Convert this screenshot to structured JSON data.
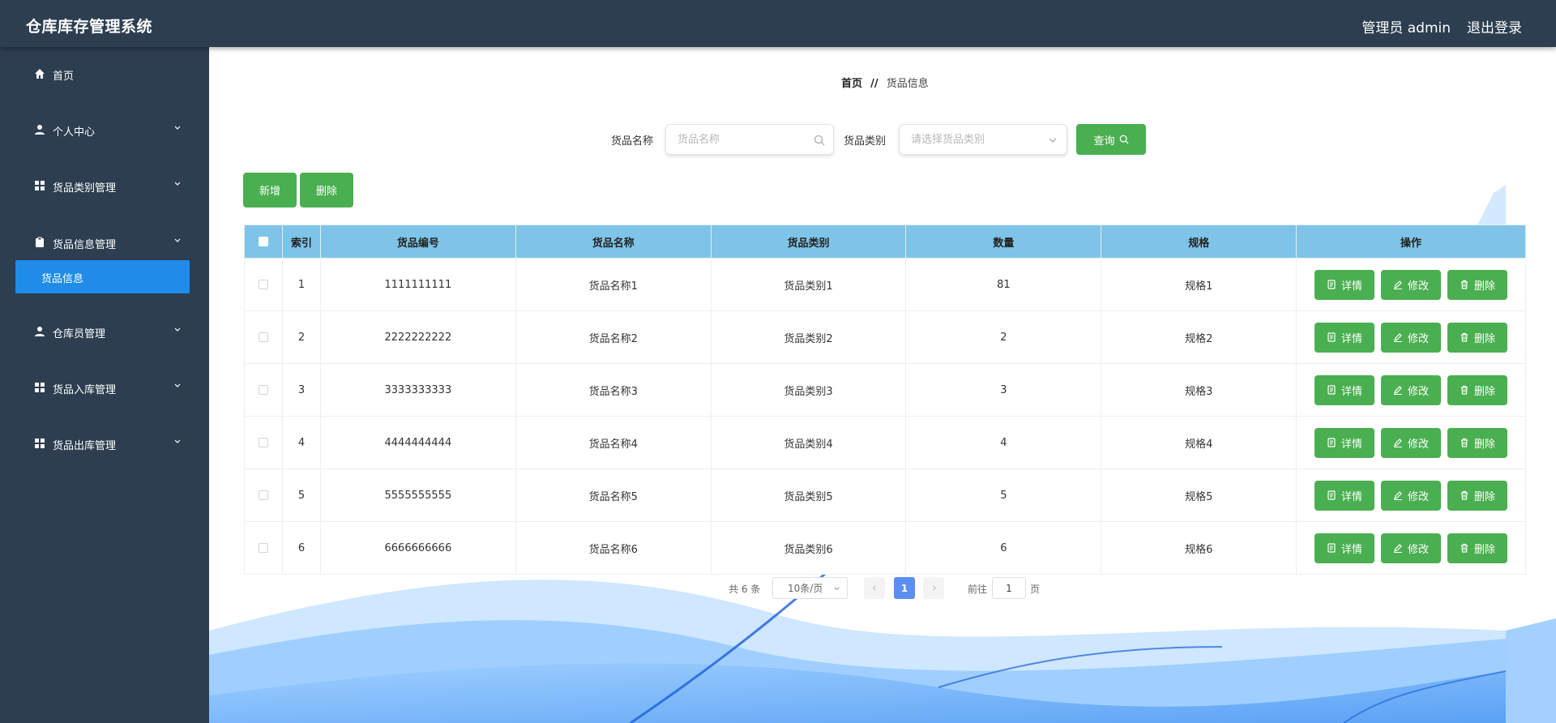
{
  "header": {
    "title": "仓库库存管理系统",
    "admin_label": "管理员 admin",
    "logout_label": "退出登录"
  },
  "sidebar": {
    "items": [
      {
        "label": "首页",
        "icon": "home-icon"
      },
      {
        "label": "个人中心",
        "icon": "user-icon"
      },
      {
        "label": "货品类别管理",
        "icon": "grid-icon"
      },
      {
        "label": "货品信息管理",
        "icon": "clipboard-icon"
      },
      {
        "label": "仓库员管理",
        "icon": "user-icon"
      },
      {
        "label": "货品入库管理",
        "icon": "grid-icon"
      },
      {
        "label": "货品出库管理",
        "icon": "grid-icon"
      }
    ],
    "active_sub": "货品信息"
  },
  "breadcrumb": {
    "home": "首页",
    "sep": "//",
    "current": "货品信息"
  },
  "search": {
    "name_label": "货品名称",
    "name_placeholder": "货品名称",
    "category_label": "货品类别",
    "category_placeholder": "请选择货品类别",
    "query_label": "查询"
  },
  "toolbar": {
    "add_label": "新增",
    "delete_label": "删除"
  },
  "table": {
    "columns": [
      "索引",
      "货品编号",
      "货品名称",
      "货品类别",
      "数量",
      "规格",
      "操作"
    ],
    "rows": [
      {
        "index": "1",
        "code": "1111111111",
        "name": "货品名称1",
        "category": "货品类别1",
        "qty": "81",
        "spec": "规格1"
      },
      {
        "index": "2",
        "code": "2222222222",
        "name": "货品名称2",
        "category": "货品类别2",
        "qty": "2",
        "spec": "规格2"
      },
      {
        "index": "3",
        "code": "3333333333",
        "name": "货品名称3",
        "category": "货品类别3",
        "qty": "3",
        "spec": "规格3"
      },
      {
        "index": "4",
        "code": "4444444444",
        "name": "货品名称4",
        "category": "货品类别4",
        "qty": "4",
        "spec": "规格4"
      },
      {
        "index": "5",
        "code": "5555555555",
        "name": "货品名称5",
        "category": "货品类别5",
        "qty": "5",
        "spec": "规格5"
      },
      {
        "index": "6",
        "code": "6666666666",
        "name": "货品名称6",
        "category": "货品类别6",
        "qty": "6",
        "spec": "规格6"
      }
    ],
    "actions": {
      "detail": "详情",
      "edit": "修改",
      "delete": "删除"
    }
  },
  "pagination": {
    "total_text": "共 6 条",
    "page_size": "10条/页",
    "current_page": "1",
    "goto_label": "前往",
    "goto_value": "1",
    "page_unit": "页"
  },
  "colors": {
    "header_bg": "#2c3e50",
    "accent_green": "#4aaf50",
    "table_head": "#7ec4e8",
    "active_blue": "#1e8ce8"
  }
}
